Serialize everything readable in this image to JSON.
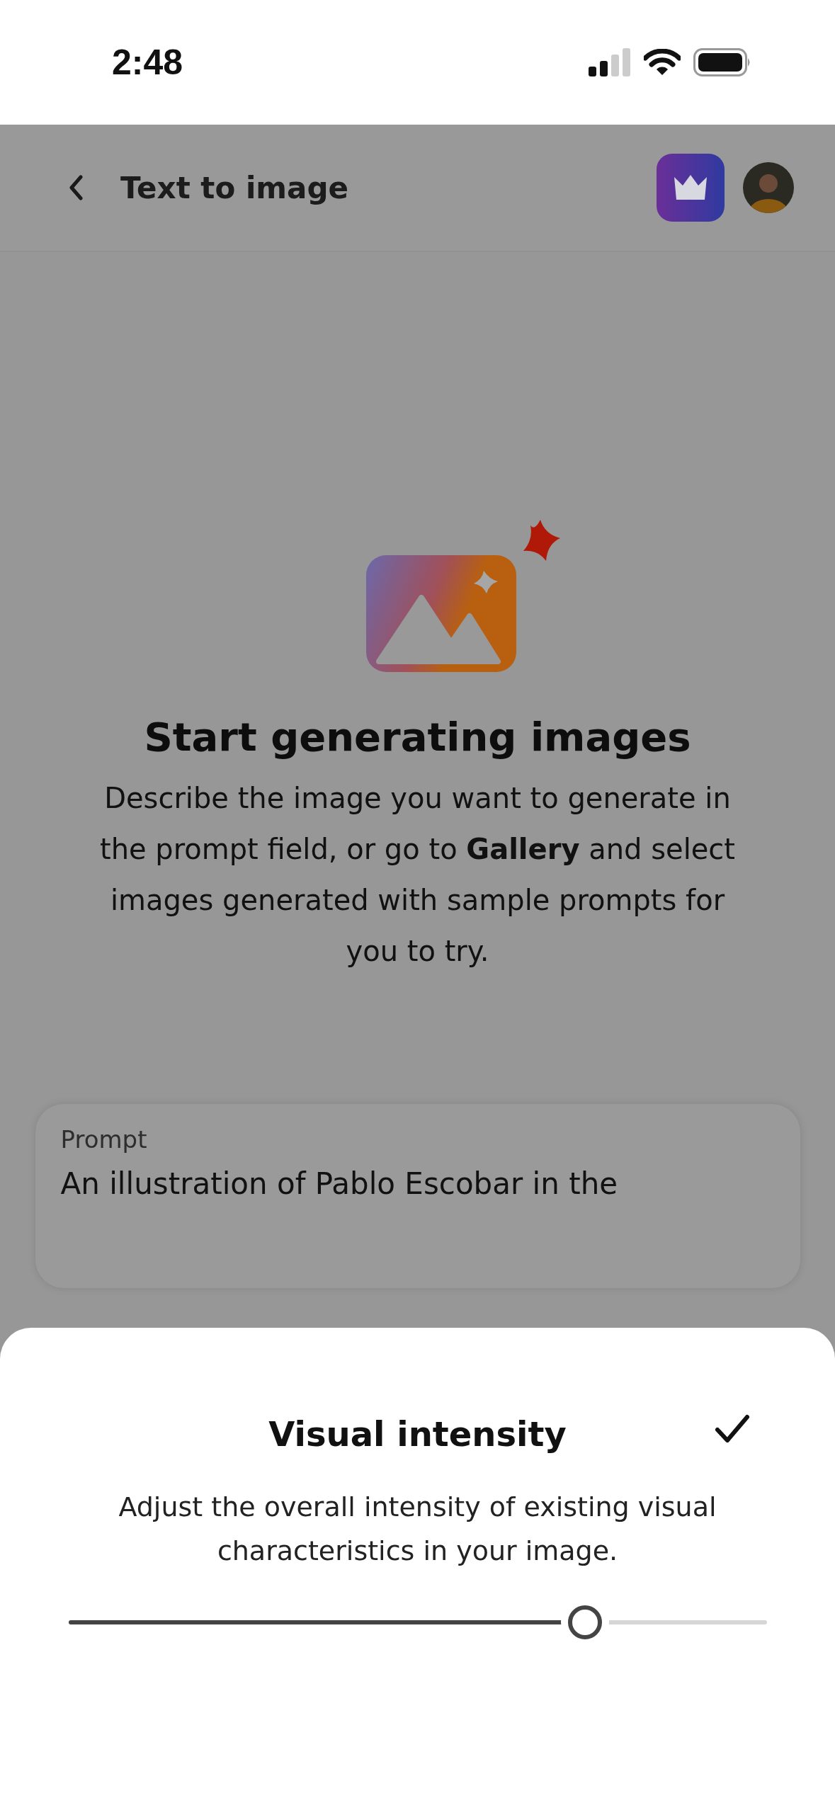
{
  "status_bar": {
    "time": "2:48"
  },
  "header": {
    "title": "Text to image"
  },
  "empty_state": {
    "title": "Start generating images",
    "description": "Describe the image you want to generate in the prompt field, or go to **Gallery** and select images generated with sample prompts for you to try."
  },
  "prompt": {
    "label": "Prompt",
    "value": "An illustration of Pablo Escobar in the"
  },
  "sheet": {
    "title": "Visual intensity",
    "description": "Adjust the overall intensity of existing visual characteristics in your image.",
    "slider": {
      "level": 0.74
    }
  }
}
